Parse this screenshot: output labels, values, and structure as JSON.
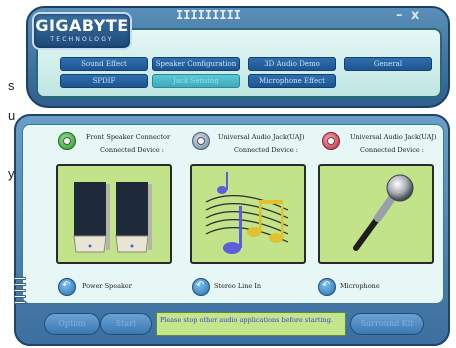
{
  "doc_margin_chars": [
    "s",
    "u",
    "y"
  ],
  "logo": {
    "name": "GIGABYTE",
    "sub": "TECHNOLOGY"
  },
  "window_controls": {
    "minimize": "–",
    "close": "x"
  },
  "tabs": {
    "row1": [
      "Sound Effect",
      "Speaker Configuration",
      "3D Audio Demo",
      "General"
    ],
    "row2": [
      "SPDIF",
      "Jack Sensing",
      "Microphone Effect"
    ],
    "active": "Jack Sensing"
  },
  "connectors": [
    {
      "title": "Front Speaker Connector",
      "sub": "Connected Device :",
      "jack_color": "#3cbf3c",
      "device": "Power Speaker"
    },
    {
      "title": "Universal Audio Jack(UAJ)",
      "sub": "Connected Device :",
      "jack_color": "#8fa4bd",
      "device": "Stereo Line In"
    },
    {
      "title": "Universal Audio Jack(UAJ)",
      "sub": "Connected Device :",
      "jack_color": "#e0455a",
      "device": "Microphone"
    }
  ],
  "buttons": {
    "option": "Option",
    "start": "Start",
    "surround": "Surround Kit"
  },
  "message": "Please stop other audio applications before starting."
}
